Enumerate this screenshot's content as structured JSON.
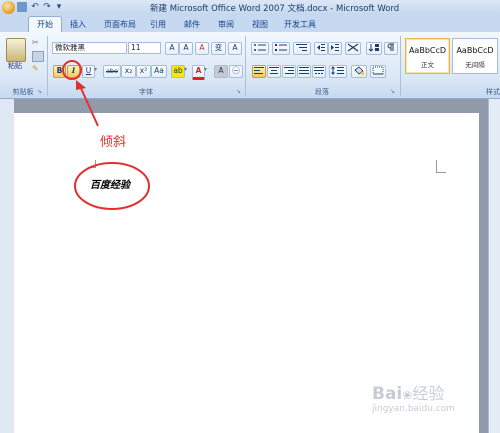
{
  "window": {
    "title": "新建 Microsoft Office Word 2007 文档.docx - Microsoft Word",
    "qat_undo": "↶",
    "qat_redo": "↷",
    "qat_more": "▾"
  },
  "tabs": [
    "开始",
    "插入",
    "页面布局",
    "引用",
    "邮件",
    "审阅",
    "视图",
    "开发工具"
  ],
  "clipboard": {
    "paste_label": "粘贴",
    "group_label": "剪贴板"
  },
  "font": {
    "name": "微软雅黑",
    "size": "11",
    "grow": "A",
    "shrink": "A",
    "clear": "A",
    "phonetic": "变",
    "border": "A",
    "bold": "B",
    "italic": "I",
    "underline": "U",
    "strike": "abe",
    "subscript": "x₂",
    "superscript": "x²",
    "case": "Aa",
    "highlight": "ab",
    "color": "A",
    "shade": "A",
    "enclose": "㊀",
    "group_label": "字体"
  },
  "paragraph": {
    "group_label": "段落"
  },
  "styles": {
    "items": [
      {
        "preview": "AaBbCcD",
        "name": "正文"
      },
      {
        "preview": "AaBbCcD",
        "name": "无间隔"
      }
    ],
    "group_label": "样式"
  },
  "annotation": {
    "label": "倾斜",
    "color": "#e03131"
  },
  "document": {
    "text": "百度经验"
  },
  "watermark": {
    "brand": "Bai",
    "suffix": "经验",
    "url": "jingyan.baidu.com"
  },
  "colors": {
    "accent": "#e03131",
    "highlight": "#ffe600",
    "font_color": "#e02020"
  }
}
